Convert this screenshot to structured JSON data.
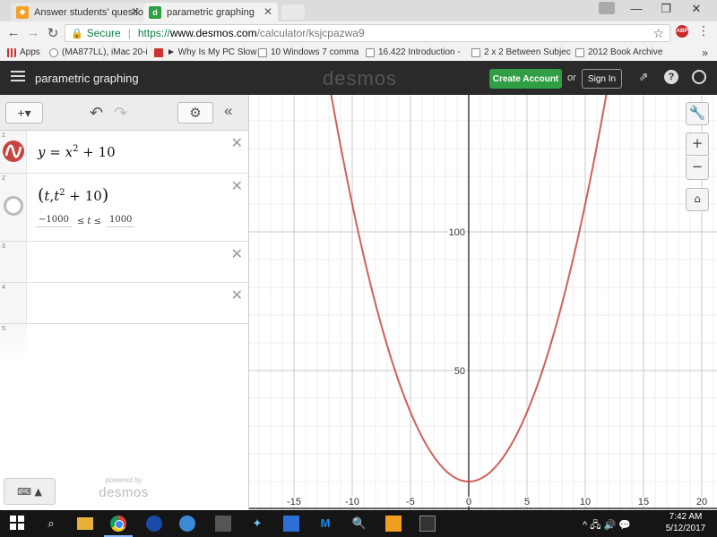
{
  "browser": {
    "tabs": [
      {
        "title": "Answer students' questio",
        "icon": "chegg-icon",
        "color": "#f4a024"
      },
      {
        "title": "parametric graphing",
        "icon": "desmos-icon",
        "color": "#2f9e44"
      }
    ],
    "window_controls": {
      "minimize": "—",
      "restore": "❐",
      "close": "✕"
    },
    "nav": {
      "back": "←",
      "forward": "→",
      "reload": "↻"
    },
    "omnibox": {
      "secure_label": "Secure",
      "separator": "|",
      "url_proto": "https://",
      "url_host": "www.desmos.com",
      "url_path": "/calculator/ksjcpazwa9"
    },
    "extension_label": "ABP",
    "bookmarks": [
      "Apps",
      "(MA877LL), iMac 20-i",
      "► Why Is My PC Slow",
      "10 Windows 7 comma",
      "16.422 Introduction -",
      "2 x 2 Between Subjec",
      "2012 Book Archive"
    ],
    "bookmarks_more": "»"
  },
  "header": {
    "title": "parametric graphing",
    "logo": "desmos",
    "create_account": "Create Account",
    "or": "or",
    "sign_in": "Sign In",
    "icons": [
      "share-icon",
      "help-icon",
      "globe-icon"
    ]
  },
  "toolbar": {
    "add": "+▾",
    "undo": "↶",
    "redo": "↷",
    "settings": "⚙",
    "collapse": "«"
  },
  "expressions": [
    {
      "index": "1",
      "latex": "y = x^2 + 10",
      "color": "#c74440",
      "visible": true
    },
    {
      "index": "2",
      "latex": "(t, t^2 + 10)",
      "visible": false,
      "domain": {
        "min": "−1000",
        "mid": "≤ t ≤",
        "max": "1000"
      }
    },
    {
      "index": "3"
    },
    {
      "index": "4"
    },
    {
      "index": "5"
    }
  ],
  "delete_glyph": "✕",
  "footer": {
    "keyboard": "⌨ ▲",
    "powered_by": "powered by",
    "logo": "desmos"
  },
  "graph_controls": {
    "wrench": "🔧",
    "zoom_in": "+",
    "zoom_out": "−",
    "home": "⌂"
  },
  "chart_data": {
    "type": "line",
    "series": [
      {
        "expression": "y = x^2 + 10",
        "color": "#c74440",
        "x_range": [
          -12,
          12
        ]
      }
    ],
    "xlim": [
      -20,
      20
    ],
    "ylim": [
      0,
      120
    ],
    "x_ticks": [
      -15,
      -10,
      -5,
      0,
      5,
      10,
      15,
      20
    ],
    "x_tick_labels": [
      "-15",
      "-10",
      "-5",
      "0",
      "5",
      "10",
      "15",
      "20"
    ],
    "y_ticks": [
      50,
      100
    ],
    "y_tick_labels": [
      "50",
      "100"
    ],
    "grid": true,
    "major_step_x": 5,
    "major_step_y": 50,
    "minor_step_x": 1,
    "minor_step_y": 10
  },
  "taskbar": {
    "icons": [
      "windows-start-icon",
      "search-icon",
      "file-explorer-icon",
      "chrome-icon",
      "firefox-icon",
      "ie-icon",
      "app-icon",
      "app-icon",
      "malwarebytes-icon",
      "magnifier-icon",
      "app-icon",
      "cmd-icon"
    ],
    "tray": "^ 🖧 🔊 💬",
    "time": "7:42 AM",
    "date": "5/12/2017"
  }
}
